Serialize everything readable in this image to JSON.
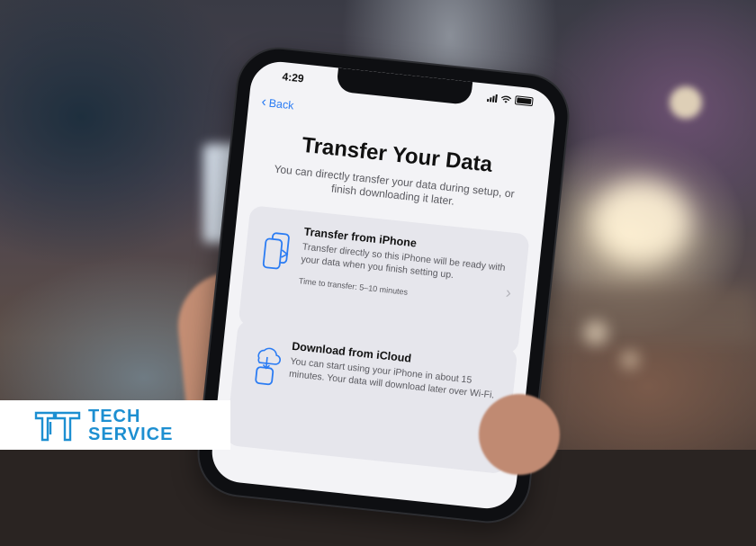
{
  "phone": {
    "status_time": "4:29",
    "back_label": "Back",
    "title": "Transfer Your Data",
    "subtitle": "You can directly transfer your data during setup, or finish downloading it later.",
    "options": [
      {
        "title": "Transfer from iPhone",
        "description": "Transfer directly so this iPhone will be ready with your data when you finish setting up.",
        "time": "Time to transfer: 5–10 minutes",
        "icon": "two-phones-icon"
      },
      {
        "title": "Download from iCloud",
        "description": "You can start using your iPhone in about 15 minutes. Your data will download later over Wi-Fi.",
        "icon": "cloud-download-icon"
      }
    ],
    "accent_color": "#2b7cf3"
  },
  "logo": {
    "line1": "TECH",
    "line2": "SERVICE",
    "color": "#1d8fd1"
  }
}
